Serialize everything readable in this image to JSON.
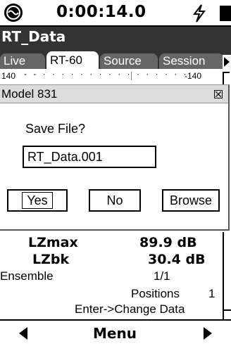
{
  "status": {
    "time": "0:00:14.0",
    "icons": [
      "logo-icon",
      "lightning-icon",
      "battery-icon"
    ]
  },
  "window": {
    "title": "RT_Data"
  },
  "tabs": [
    {
      "label": "Live",
      "active": false
    },
    {
      "label": "RT-60",
      "active": true
    },
    {
      "label": "Source",
      "active": false
    },
    {
      "label": "Session",
      "active": false
    }
  ],
  "scale": {
    "left": "140",
    "dots": "- - · · · · · · · · ·   · · · · · · ·",
    "right": "-140"
  },
  "dialog": {
    "title": "Model 831",
    "prompt": "Save File?",
    "filename": "RT_Data.001",
    "buttons": {
      "yes": "Yes",
      "no": "No",
      "browse": "Browse"
    }
  },
  "results": {
    "lzmax_label": "LZmax",
    "lzmax_value": "89.9 dB",
    "lzbk_label": "LZbk",
    "lzbk_value": "30.4 dB",
    "ensemble_label": "Ensemble",
    "ensemble_value": "1/1",
    "positions_label": "Positions",
    "positions_value": "1",
    "enter_text": "Enter->Change Data"
  },
  "bottom": {
    "menu_label": "Menu"
  },
  "colors": {
    "titlebar": "#333333",
    "tab_inactive": "#666666",
    "dialog_head": "#dcdcdc"
  }
}
